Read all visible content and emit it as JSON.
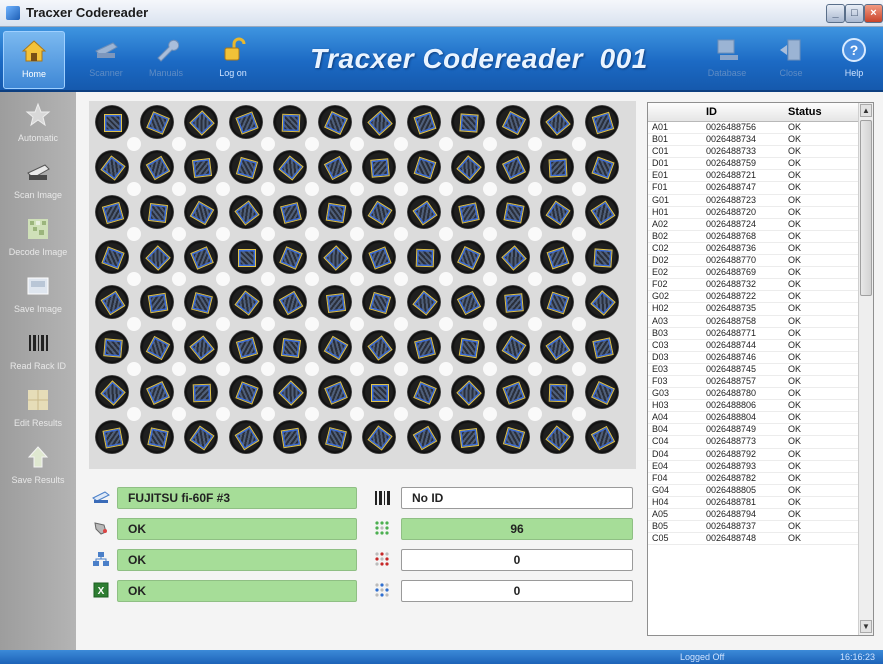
{
  "window": {
    "title": "Tracxer Codereader"
  },
  "toolbar": {
    "items": [
      {
        "label": "Home",
        "icon": "home-icon"
      },
      {
        "label": "Scanner",
        "icon": "scanner-icon"
      },
      {
        "label": "Manuals",
        "icon": "wrench-icon"
      },
      {
        "label": "Log on",
        "icon": "padlock-icon"
      }
    ],
    "right_items": [
      {
        "label": "Database",
        "icon": "computer-icon"
      },
      {
        "label": "Close",
        "icon": "exit-door-icon"
      },
      {
        "label": "Help",
        "icon": "help-icon"
      }
    ],
    "app_title": "Tracxer Codereader  001"
  },
  "sidebar": {
    "items": [
      {
        "label": "Automatic",
        "icon": "star-icon"
      },
      {
        "label": "Scan Image",
        "icon": "scanner-icon"
      },
      {
        "label": "Decode Image",
        "icon": "decode-icon"
      },
      {
        "label": "Save Image",
        "icon": "save-image-icon"
      },
      {
        "label": "Read Rack ID",
        "icon": "barcode-icon"
      },
      {
        "label": "Edit Results",
        "icon": "edit-results-icon"
      },
      {
        "label": "Save Results",
        "icon": "save-results-icon"
      }
    ]
  },
  "status_fields": {
    "scanner": "FUJITSU fi-60F #3",
    "rack_id": "No ID",
    "field2": "OK",
    "field3": "OK",
    "field4": "OK",
    "count_ok": "96",
    "count_error": "0",
    "count_empty": "0"
  },
  "results_table": {
    "columns": [
      "",
      "ID",
      "Status"
    ],
    "rows": [
      [
        "A01",
        "0026488756",
        "OK"
      ],
      [
        "B01",
        "0026488734",
        "OK"
      ],
      [
        "C01",
        "0026488733",
        "OK"
      ],
      [
        "D01",
        "0026488759",
        "OK"
      ],
      [
        "E01",
        "0026488721",
        "OK"
      ],
      [
        "F01",
        "0026488747",
        "OK"
      ],
      [
        "G01",
        "0026488723",
        "OK"
      ],
      [
        "H01",
        "0026488720",
        "OK"
      ],
      [
        "A02",
        "0026488724",
        "OK"
      ],
      [
        "B02",
        "0026488768",
        "OK"
      ],
      [
        "C02",
        "0026488736",
        "OK"
      ],
      [
        "D02",
        "0026488770",
        "OK"
      ],
      [
        "E02",
        "0026488769",
        "OK"
      ],
      [
        "F02",
        "0026488732",
        "OK"
      ],
      [
        "G02",
        "0026488722",
        "OK"
      ],
      [
        "H02",
        "0026488735",
        "OK"
      ],
      [
        "A03",
        "0026488758",
        "OK"
      ],
      [
        "B03",
        "0026488771",
        "OK"
      ],
      [
        "C03",
        "0026488744",
        "OK"
      ],
      [
        "D03",
        "0026488746",
        "OK"
      ],
      [
        "E03",
        "0026488745",
        "OK"
      ],
      [
        "F03",
        "0026488757",
        "OK"
      ],
      [
        "G03",
        "0026488780",
        "OK"
      ],
      [
        "H03",
        "0026488806",
        "OK"
      ],
      [
        "A04",
        "0026488804",
        "OK"
      ],
      [
        "B04",
        "0026488749",
        "OK"
      ],
      [
        "C04",
        "0026488773",
        "OK"
      ],
      [
        "D04",
        "0026488792",
        "OK"
      ],
      [
        "E04",
        "0026488793",
        "OK"
      ],
      [
        "F04",
        "0026488782",
        "OK"
      ],
      [
        "G04",
        "0026488805",
        "OK"
      ],
      [
        "H04",
        "0026488781",
        "OK"
      ],
      [
        "A05",
        "0026488794",
        "OK"
      ],
      [
        "B05",
        "0026488737",
        "OK"
      ],
      [
        "C05",
        "0026488748",
        "OK"
      ]
    ]
  },
  "statusbar": {
    "login_state": "Logged Off",
    "time": "16:16:23"
  },
  "colors": {
    "accent": "#1c6ac4",
    "ok_green": "#a6dd98"
  }
}
